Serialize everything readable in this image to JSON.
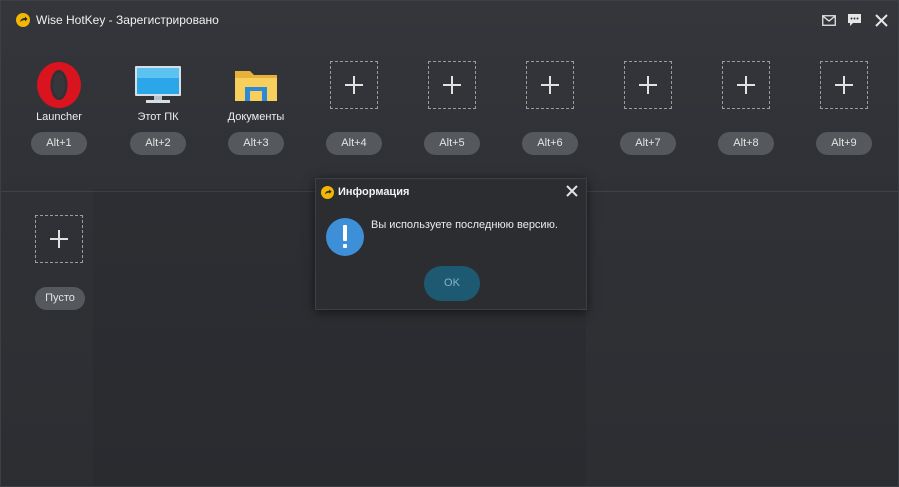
{
  "window": {
    "title": "Wise HotKey - Зарегистрировано"
  },
  "titlebar_icons": [
    "mail-icon",
    "feedback-icon",
    "close-icon"
  ],
  "slots": [
    {
      "label": "Launcher",
      "hotkey": "Alt+1",
      "icon": "opera-icon",
      "empty": false
    },
    {
      "label": "Этот ПК",
      "hotkey": "Alt+2",
      "icon": "monitor-icon",
      "empty": false
    },
    {
      "label": "Документы",
      "hotkey": "Alt+3",
      "icon": "folder-icon",
      "empty": false
    },
    {
      "label": "",
      "hotkey": "Alt+4",
      "icon": "plus-icon",
      "empty": true
    },
    {
      "label": "",
      "hotkey": "Alt+5",
      "icon": "plus-icon",
      "empty": true
    },
    {
      "label": "",
      "hotkey": "Alt+6",
      "icon": "plus-icon",
      "empty": true
    },
    {
      "label": "",
      "hotkey": "Alt+7",
      "icon": "plus-icon",
      "empty": true
    },
    {
      "label": "",
      "hotkey": "Alt+8",
      "icon": "plus-icon",
      "empty": true
    },
    {
      "label": "",
      "hotkey": "Alt+9",
      "icon": "plus-icon",
      "empty": true
    }
  ],
  "second_row": {
    "add_slot": {
      "icon": "plus-icon",
      "label": "Пусто"
    }
  },
  "dialog": {
    "title": "Информация",
    "message": "Вы используете последнюю версию.",
    "ok_label": "OK",
    "icon": "info-exclamation-icon"
  },
  "colors": {
    "background": "#2f3135",
    "accent_yellow": "#f2b705",
    "info_blue": "#3d8fd8",
    "ok_button": "#1d5a72",
    "hotkey_pill": "#55585d"
  }
}
